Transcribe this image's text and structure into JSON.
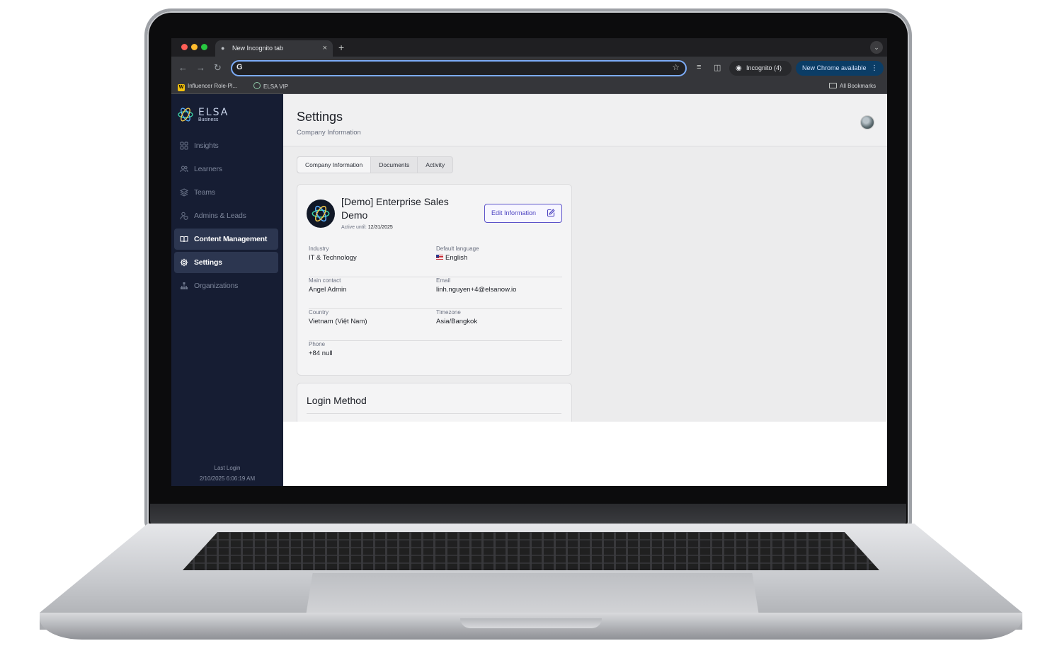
{
  "browser": {
    "tab_title": "New Incognito tab",
    "address_value": "",
    "incognito_label": "Incognito (4)",
    "update_label": "New Chrome available",
    "bookmarks": [
      "Influencer Role-Pl...",
      "ELSA VIP"
    ],
    "all_bookmarks": "All Bookmarks"
  },
  "brand": {
    "name": "ELSA",
    "sub": "Business",
    "accent": "#4b41c0",
    "sidebar_bg": "#161d33"
  },
  "sidebar": {
    "items": [
      {
        "label": "Insights",
        "icon": "grid-icon"
      },
      {
        "label": "Learners",
        "icon": "users-icon"
      },
      {
        "label": "Teams",
        "icon": "layers-icon"
      },
      {
        "label": "Admins & Leads",
        "icon": "user-shield-icon"
      },
      {
        "label": "Content Management",
        "icon": "book-icon"
      },
      {
        "label": "Settings",
        "icon": "gear-icon"
      },
      {
        "label": "Organizations",
        "icon": "org-chart-icon"
      }
    ],
    "last_login_label": "Last Login",
    "last_login_value": "2/10/2025 6:06:19 AM"
  },
  "header": {
    "title": "Settings",
    "subtitle": "Company Information"
  },
  "tabs": [
    "Company Information",
    "Documents",
    "Activity"
  ],
  "company": {
    "name": "[Demo] Enterprise Sales Demo",
    "active_until_label": "Active until:",
    "active_until_value": "12/31/2025",
    "edit_label": "Edit Information",
    "fields": [
      {
        "label": "Industry",
        "value": "IT & Technology"
      },
      {
        "label": "Default language",
        "value": "English"
      },
      {
        "label": "Main contact",
        "value": "Angel Admin"
      },
      {
        "label": "Email",
        "value": "linh.nguyen+4@elsanow.io"
      },
      {
        "label": "Country",
        "value": "Vietnam (Việt Nam)"
      },
      {
        "label": "Timezone",
        "value": "Asia/Bangkok"
      },
      {
        "label": "Phone",
        "value": "+84 null"
      }
    ]
  },
  "login_method": {
    "title": "Login Method"
  }
}
